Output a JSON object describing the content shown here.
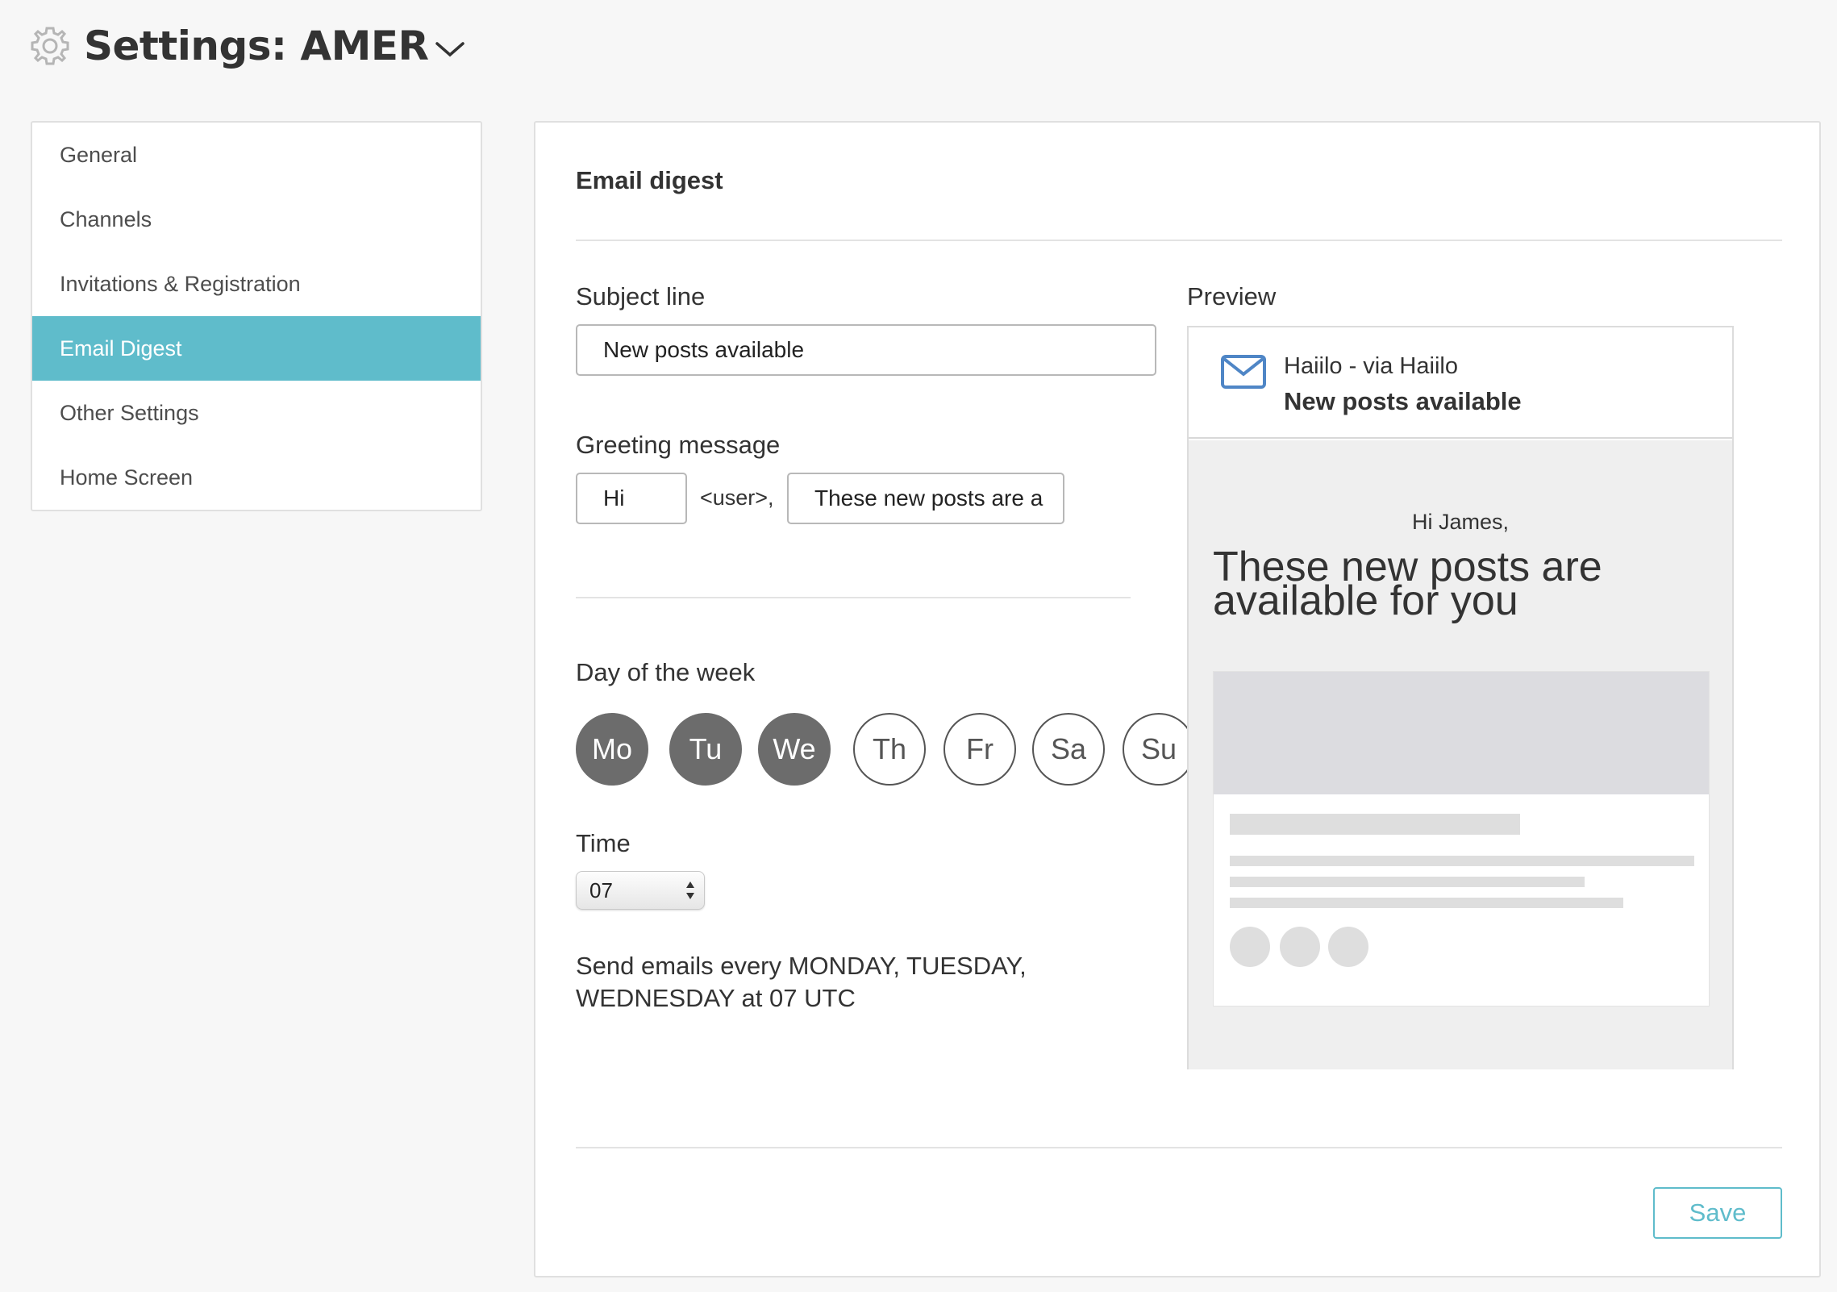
{
  "header": {
    "title": "Settings: AMER",
    "icon": "gear-icon",
    "dropdown_icon": "chevron-down-icon"
  },
  "sidebar": {
    "items": [
      {
        "label": "General"
      },
      {
        "label": "Channels"
      },
      {
        "label": "Invitations & Registration"
      },
      {
        "label": "Email Digest",
        "active": true
      },
      {
        "label": "Other Settings"
      },
      {
        "label": "Home Screen"
      }
    ]
  },
  "panel": {
    "title": "Email digest",
    "subject": {
      "label": "Subject line",
      "value": "New posts available"
    },
    "greeting": {
      "label": "Greeting message",
      "hi_value": "Hi",
      "user_tag": "<user>,",
      "message_value": "These new posts are a"
    },
    "days": {
      "label": "Day of the week",
      "items": [
        {
          "label": "Mo",
          "selected": true
        },
        {
          "label": "Tu",
          "selected": true
        },
        {
          "label": "We",
          "selected": true
        },
        {
          "label": "Th",
          "selected": false
        },
        {
          "label": "Fr",
          "selected": false
        },
        {
          "label": "Sa",
          "selected": false
        },
        {
          "label": "Su",
          "selected": false
        }
      ]
    },
    "time": {
      "label": "Time",
      "value": "07"
    },
    "summary": "Send emails every MONDAY, TUESDAY, WEDNESDAY at 07 UTC",
    "save_label": "Save"
  },
  "preview": {
    "label": "Preview",
    "sender": "Haiilo - via Haiilo",
    "subject": "New posts available",
    "greeting": "Hi James,",
    "headline": "These new posts are available for you"
  },
  "colors": {
    "accent": "#5fbccb",
    "day_selected": "#6c6c6c",
    "mail_icon": "#4f86c6"
  }
}
